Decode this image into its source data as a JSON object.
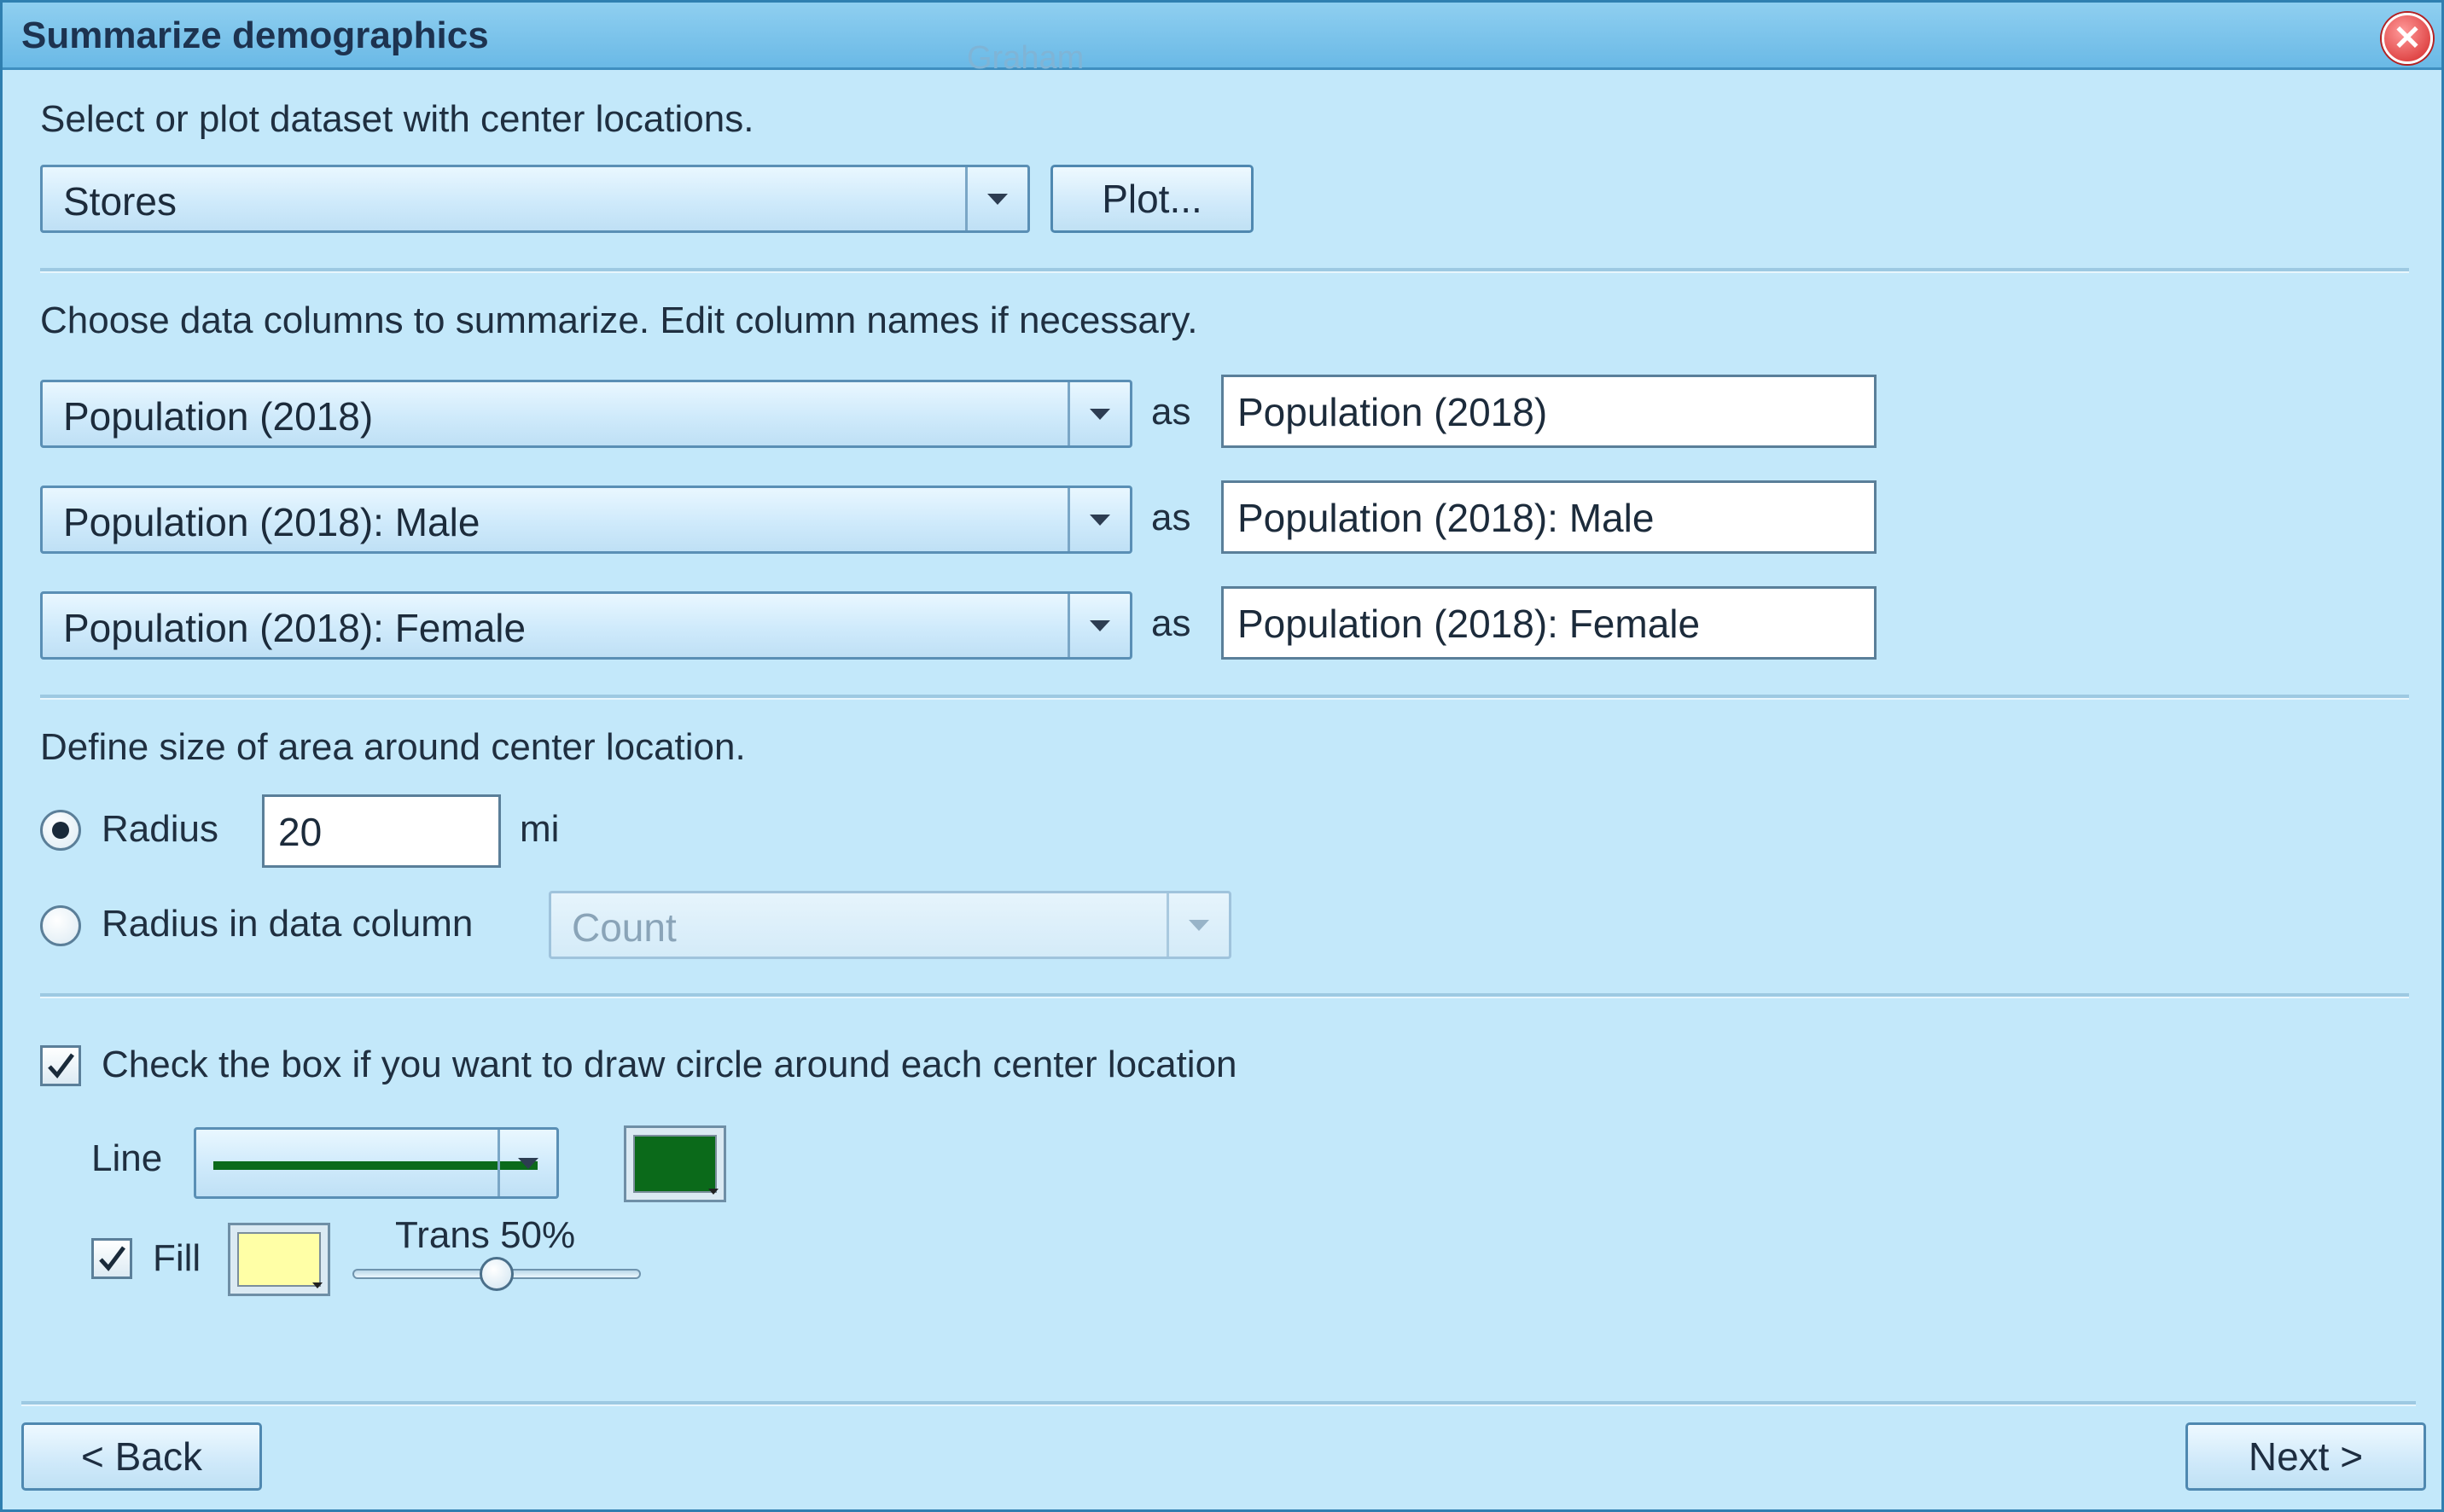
{
  "window": {
    "title": "Summarize demographics",
    "map_background_label": "Graham"
  },
  "dataset": {
    "instruction": "Select or plot dataset with center locations.",
    "selected": "Stores",
    "plot_button": "Plot..."
  },
  "columns": {
    "instruction": "Choose data columns to summarize. Edit column names if necessary.",
    "as_label": "as",
    "rows": [
      {
        "column": "Population (2018)",
        "alias": "Population (2018)"
      },
      {
        "column": "Population (2018): Male",
        "alias": "Population (2018): Male"
      },
      {
        "column": "Population (2018): Female",
        "alias": "Population (2018): Female"
      }
    ]
  },
  "area": {
    "instruction": "Define size of area around center location.",
    "radius_label": "Radius",
    "radius_value": "20",
    "radius_unit": "mi",
    "radius_selected": true,
    "data_column_label": "Radius in data column",
    "data_column_value": "Count",
    "data_column_selected": false
  },
  "circle": {
    "checkbox_label": "Check the box if you want to draw circle around each center location",
    "checked": true,
    "line_label": "Line",
    "line_color": "#0b6a1a",
    "fill_label": "Fill",
    "fill_checked": true,
    "fill_color": "#ffffa6",
    "transparency_label": "Trans 50%",
    "transparency_value": 0.5
  },
  "footer": {
    "back_button": "< Back",
    "next_button": "Next >"
  },
  "colors": {
    "dialog_bg": "#c3e8fa",
    "title_bar": "#7fc4ec",
    "close": "#d42828"
  }
}
